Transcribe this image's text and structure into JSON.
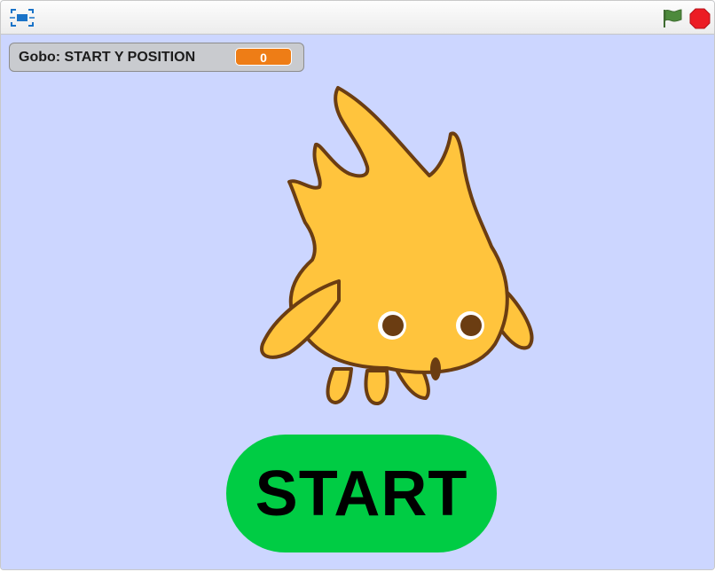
{
  "monitor": {
    "label": "Gobo: START Y POSITION",
    "value": "0"
  },
  "stage_button": {
    "label": "START"
  },
  "colors": {
    "stage_background": "#ccd6ff",
    "monitor_value_bg": "#ee7d16",
    "start_button": "#00cc44",
    "sprite_body": "#ffc43d",
    "sprite_outline": "#6b3d12",
    "flag": "#4d8a3c",
    "stop": "#ec1c24"
  },
  "icons": {
    "fullscreen": "fullscreen-icon",
    "green_flag": "green-flag-icon",
    "stop": "stop-sign-icon"
  }
}
